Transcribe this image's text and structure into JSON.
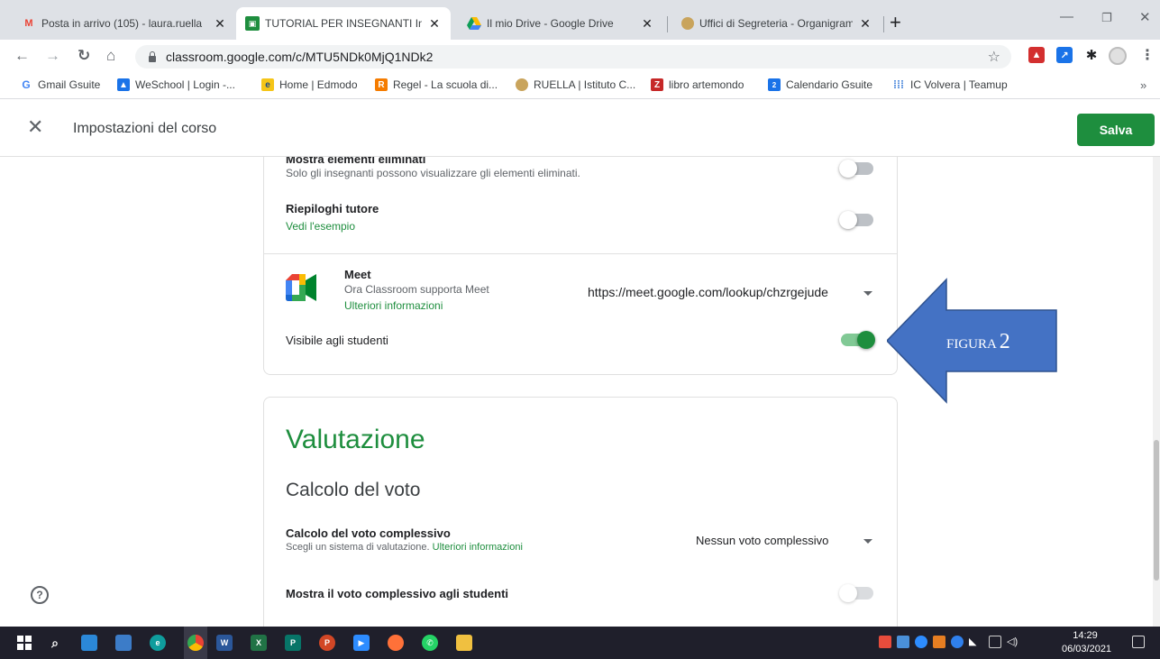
{
  "browser": {
    "tabs": [
      {
        "title": "Posta in arrivo (105) - laura.ruella",
        "icon": "gmail-icon"
      },
      {
        "title": "TUTORIAL PER INSEGNANTI Infan",
        "icon": "classroom-icon"
      },
      {
        "title": "Il mio Drive - Google Drive",
        "icon": "drive-icon"
      },
      {
        "title": "Uffici di Segreteria - Organigramm",
        "icon": "school-crest-icon"
      }
    ],
    "url": "classroom.google.com/c/MTU5NDk0MjQ1NDk2",
    "bookmarks": [
      "Gmail Gsuite",
      "WeSchool | Login -...",
      "Home | Edmodo",
      "Regel - La scuola di...",
      "RUELLA | Istituto C...",
      "libro artemondo",
      "Calendario Gsuite",
      "IC Volvera | Teamup"
    ]
  },
  "header": {
    "title": "Impostazioni del corso",
    "save_label": "Salva"
  },
  "settings": {
    "deleted_items": {
      "label": "Mostra elementi eliminati",
      "sub": "Solo gli insegnanti possono visualizzare gli elementi eliminati.",
      "enabled": false
    },
    "guardian_summaries": {
      "label": "Riepiloghi tutore",
      "link": "Vedi l'esempio",
      "enabled": false
    },
    "meet": {
      "label": "Meet",
      "sub": "Ora Classroom supporta Meet",
      "link": "Ulteriori informazioni",
      "url": "https://meet.google.com/lookup/chzrgejude",
      "visible_label": "Visibile agli studenti",
      "visible_enabled": true
    }
  },
  "grading": {
    "heading": "Valutazione",
    "subheading": "Calcolo del voto",
    "overall": {
      "label": "Calcolo del voto complessivo",
      "sub": "Scegli un sistema di valutazione.",
      "link": "Ulteriori informazioni",
      "value": "Nessun voto complessivo"
    },
    "show_overall": {
      "label": "Mostra il voto complessivo agli studenti",
      "enabled": false
    }
  },
  "annotation": {
    "text_prefix": "FIGURA",
    "text_number": "2",
    "color": "#4472c4"
  },
  "taskbar": {
    "time": "14:29",
    "date": "06/03/2021"
  },
  "colors": {
    "accent": "#1e8e3e"
  }
}
